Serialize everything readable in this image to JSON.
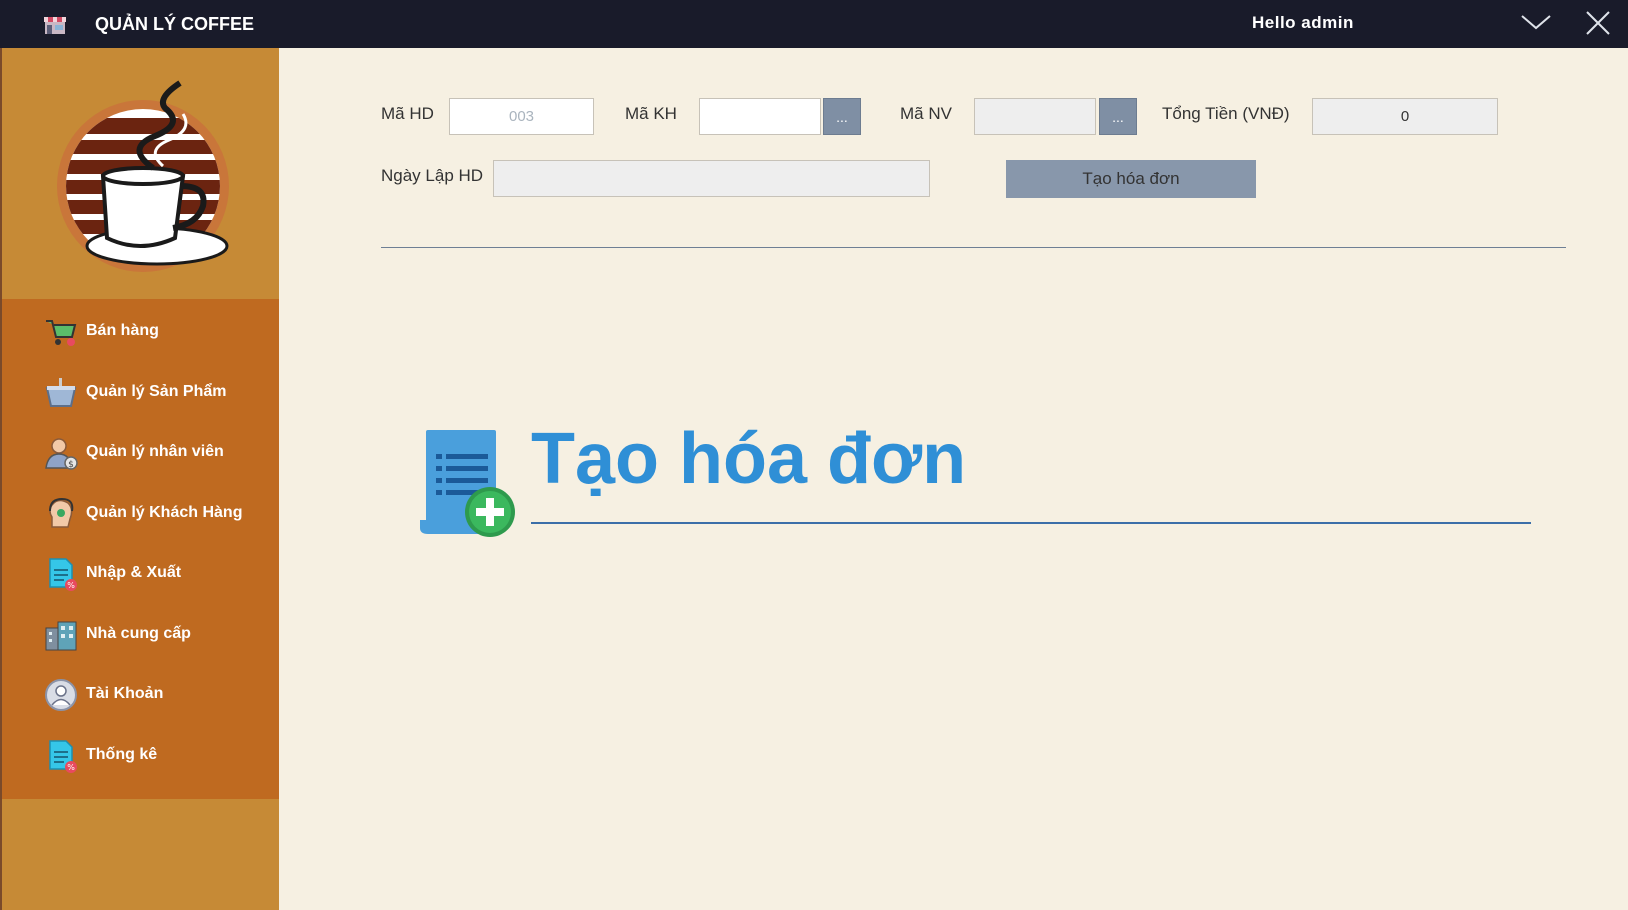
{
  "titlebar": {
    "title": "QUẢN LÝ COFFEE",
    "greeting": "Hello admin",
    "minimize_icon": "chevron-down-icon",
    "close_icon": "close-icon"
  },
  "sidebar": {
    "items": [
      {
        "label": "Bán hàng",
        "icon": "cart-icon"
      },
      {
        "label": "Quản lý Sản Phẩm",
        "icon": "coffee-cup-icon"
      },
      {
        "label": "Quản lý nhân viên",
        "icon": "employee-icon"
      },
      {
        "label": "Quản lý Khách Hàng",
        "icon": "customer-icon"
      },
      {
        "label": "Nhập & Xuất",
        "icon": "document-icon"
      },
      {
        "label": "Nhà cung cấp",
        "icon": "building-icon"
      },
      {
        "label": "Tài Khoản",
        "icon": "account-icon"
      },
      {
        "label": "Thống kê",
        "icon": "document-icon"
      }
    ]
  },
  "form": {
    "invoice_id_label": "Mã HD",
    "invoice_id_value": "003",
    "customer_id_label": "Mã KH",
    "customer_id_value": "",
    "employee_id_label": "Mã NV",
    "employee_id_value": "",
    "total_label": "Tổng Tiền (VNĐ)",
    "total_value": "0",
    "date_label": "Ngày Lập HD",
    "date_value": "",
    "browse_label": "...",
    "create_button": "Tạo hóa đơn"
  },
  "hero": {
    "title": "Tạo hóa đơn",
    "icon": "add-invoice-icon"
  },
  "colors": {
    "titlebar": "#191b2a",
    "sidebar": "#c68a36",
    "menu": "#bf6a20",
    "content": "#f6f0e2",
    "accent": "#2f8fd6"
  }
}
